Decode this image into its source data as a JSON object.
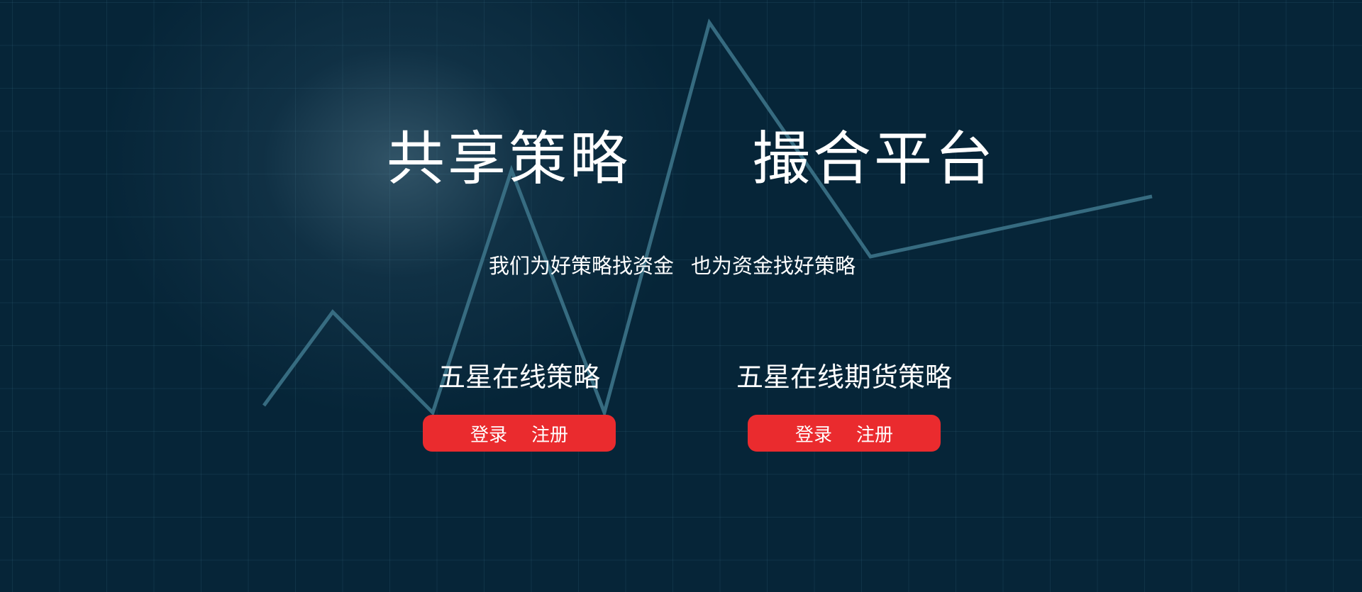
{
  "hero": {
    "title_left": "共享策略",
    "title_right": "撮合平台",
    "tagline_part1": "我们为好策略找资金",
    "tagline_part2": "也为资金找好策略"
  },
  "products": [
    {
      "title": "五星在线策略",
      "login_label": "登录",
      "register_label": "注册"
    },
    {
      "title": "五星在线期货策略",
      "login_label": "登录",
      "register_label": "注册"
    }
  ],
  "colors": {
    "background": "#062538",
    "button": "#ea2b2e",
    "trend_line": "#3c7388"
  }
}
